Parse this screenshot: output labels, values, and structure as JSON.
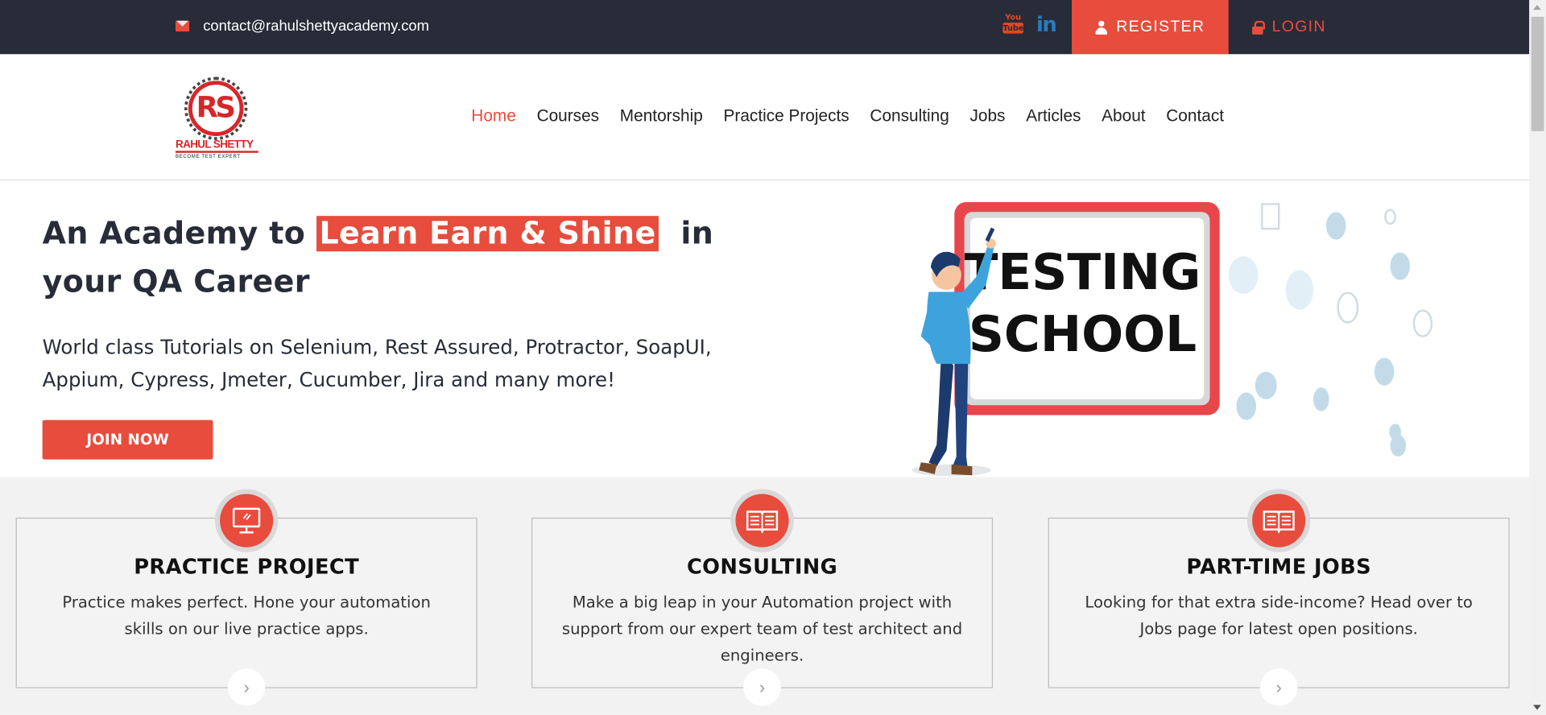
{
  "topbar": {
    "email": "contact@rahulshettyacademy.com",
    "register_label": "REGISTER",
    "login_label": "LOGIN",
    "youtube_label": "You Tube",
    "linkedin_label": "in"
  },
  "logo": {
    "monogram": "RS",
    "name": "RAHUL SHETTY",
    "tagline": "BECOME TEST EXPERT"
  },
  "nav": {
    "items": [
      "Home",
      "Courses",
      "Mentorship",
      "Practice Projects",
      "Consulting",
      "Jobs",
      "Articles",
      "About",
      "Contact"
    ],
    "active": "Home"
  },
  "hero": {
    "title_pre": "An Academy to ",
    "title_highlight": "Learn Earn & Shine",
    "title_post": "  in your QA Career",
    "subtitle": "World class Tutorials on Selenium, Rest Assured, Protractor, SoapUI, Appium, Cypress, Jmeter, Cucumber, Jira and many more!",
    "cta_label": "JOIN NOW",
    "board_line1": "TESTING",
    "board_line2": "SCHOOL"
  },
  "features": [
    {
      "title": "PRACTICE PROJECT",
      "text": "Practice makes perfect. Hone your automation skills on our live practice apps.",
      "icon": "monitor-icon"
    },
    {
      "title": "CONSULTING",
      "text": "Make a big leap in your Automation project with support from our expert team of test architect and engineers.",
      "icon": "book-icon"
    },
    {
      "title": "PART-TIME JOBS",
      "text": "Looking for that extra side-income? Head over to Jobs page for latest open positions.",
      "icon": "book-icon"
    }
  ],
  "colors": {
    "accent": "#e84c3d",
    "topbar_bg": "#272c38",
    "text_dark": "#272c38"
  }
}
